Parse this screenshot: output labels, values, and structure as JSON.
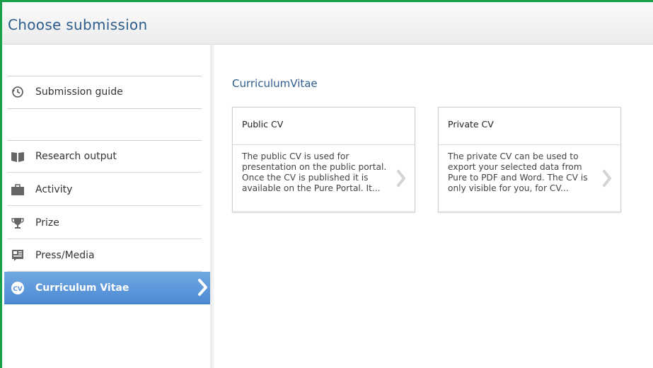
{
  "header": {
    "title": "Choose submission"
  },
  "sidebar": {
    "guide": {
      "label": "Submission guide"
    },
    "items": [
      {
        "label": "Research output"
      },
      {
        "label": "Activity"
      },
      {
        "label": "Prize"
      },
      {
        "label": "Press/Media"
      },
      {
        "label": "Curriculum Vitae"
      }
    ]
  },
  "main": {
    "section_title": "CurriculumVitae",
    "cards": [
      {
        "title": "Public CV",
        "description": "The public CV is used for presentation on the public portal. Once the CV is published it is available on the Pure Portal. It..."
      },
      {
        "title": "Private CV",
        "description": "The private CV can be used to export your selected data from Pure to PDF and Word. The CV is only visible for you, for CV..."
      }
    ]
  },
  "colors": {
    "accent": "#2d5d8c",
    "active_nav": "#5b95d9",
    "border": "#1aa04a"
  },
  "icons": [
    "history-icon",
    "book-icon",
    "briefcase-icon",
    "trophy-icon",
    "newspaper-icon",
    "cv-icon",
    "chevron-right-icon"
  ]
}
